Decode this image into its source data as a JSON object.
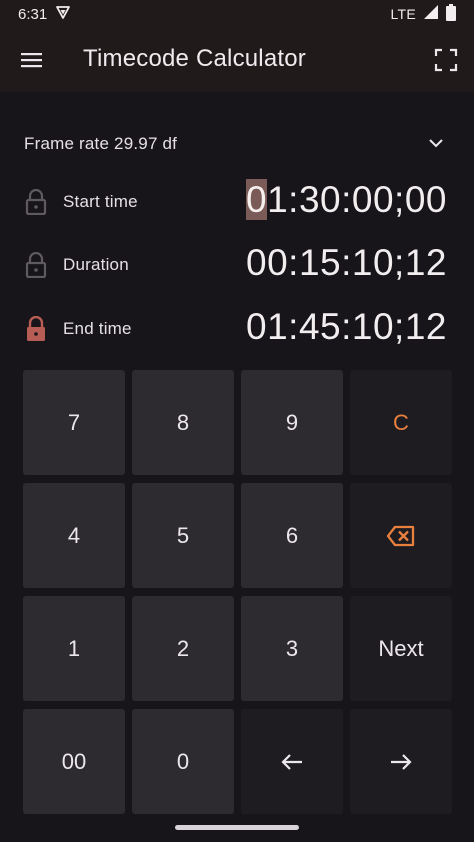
{
  "status_bar": {
    "time": "6:31",
    "network": "LTE",
    "icons": [
      "vpn-shield-icon",
      "signal-icon",
      "battery-icon"
    ]
  },
  "app_bar": {
    "title": "Timecode Calculator",
    "menu_icon": "hamburger-menu-icon",
    "fullscreen_icon": "fullscreen-icon"
  },
  "frame_rate": {
    "label": "Frame rate 29.97 df",
    "icon": "chevron-down-icon"
  },
  "rows": {
    "start": {
      "label": "Start time",
      "cursor_char": "0",
      "value_rest": "1:30:00;00",
      "locked": false
    },
    "duration": {
      "label": "Duration",
      "value": "00:15:10;12",
      "locked": false
    },
    "end": {
      "label": "End time",
      "value": "01:45:10;12",
      "locked": true
    }
  },
  "keypad": {
    "k7": "7",
    "k8": "8",
    "k9": "9",
    "clear": "C",
    "k4": "4",
    "k5": "5",
    "k6": "6",
    "backspace_icon": "backspace-icon",
    "k1": "1",
    "k2": "2",
    "k3": "3",
    "next": "Next",
    "k00": "00",
    "k0": "0",
    "left_icon": "arrow-left-icon",
    "right_icon": "arrow-right-icon"
  },
  "colors": {
    "background": "#17151a",
    "app_bar": "#201a1b",
    "key": "#2d2b30",
    "key_dark": "#1e1c20",
    "accent_orange": "#e8803e",
    "lock_active": "#b75d55",
    "cursor_highlight": "#7a5b58"
  }
}
